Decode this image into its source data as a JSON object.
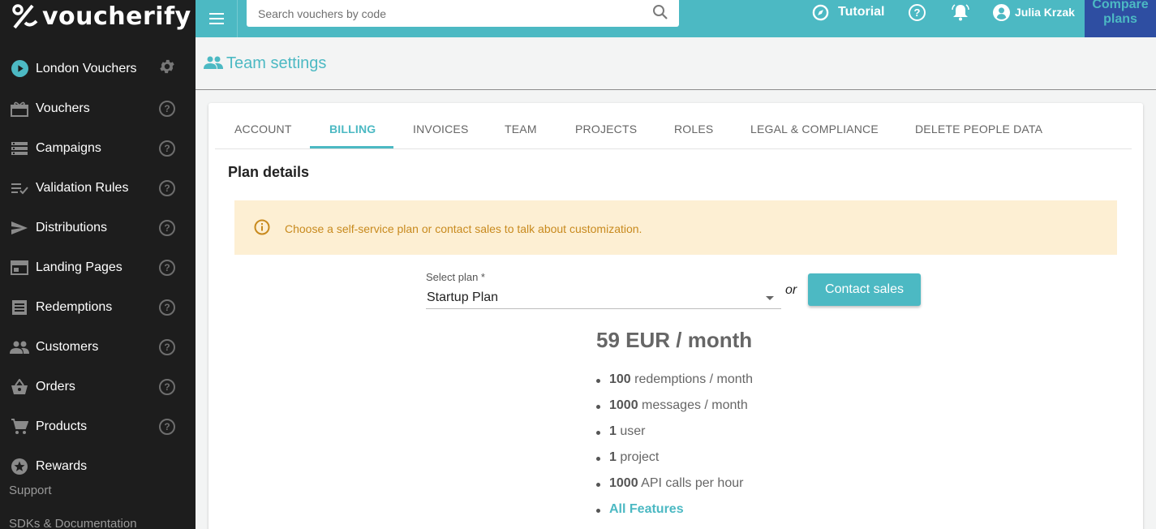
{
  "app": {
    "name": "voucherify"
  },
  "colors": {
    "accent": "#4cb9c3",
    "sidebar": "#1d1d1d",
    "compare_bg": "#2e4ea2",
    "alert_bg": "#fdefd3",
    "alert_text": "#c88a1e"
  },
  "sidebar": {
    "project": {
      "label": "London Vouchers",
      "icon": "play-circle-icon"
    },
    "items": [
      {
        "label": "Vouchers",
        "icon": "gift-icon"
      },
      {
        "label": "Campaigns",
        "icon": "list-icon"
      },
      {
        "label": "Validation Rules",
        "icon": "rules-icon"
      },
      {
        "label": "Distributions",
        "icon": "send-icon"
      },
      {
        "label": "Landing Pages",
        "icon": "web-icon"
      },
      {
        "label": "Redemptions",
        "icon": "receipt-icon"
      },
      {
        "label": "Customers",
        "icon": "people-icon"
      },
      {
        "label": "Orders",
        "icon": "basket-icon"
      },
      {
        "label": "Products",
        "icon": "cart-icon"
      },
      {
        "label": "Rewards",
        "icon": "star-icon"
      }
    ],
    "links": {
      "support": "Support",
      "sdks": "SDKs & Documentation"
    }
  },
  "topbar": {
    "search_placeholder": "Search vouchers by code",
    "tutorial": "Tutorial",
    "user": "Julia Krzak",
    "compare": "Compare plans"
  },
  "page": {
    "title": "Team settings"
  },
  "tabs": [
    {
      "label": "ACCOUNT",
      "active": false
    },
    {
      "label": "BILLING",
      "active": true
    },
    {
      "label": "INVOICES",
      "active": false
    },
    {
      "label": "TEAM",
      "active": false
    },
    {
      "label": "PROJECTS",
      "active": false
    },
    {
      "label": "ROLES",
      "active": false
    },
    {
      "label": "LEGAL & COMPLIANCE",
      "active": false
    },
    {
      "label": "DELETE PEOPLE DATA",
      "active": false
    }
  ],
  "billing": {
    "section_title": "Plan details",
    "alert": "Choose a self-service plan or contact sales to talk about customization.",
    "select_label": "Select plan *",
    "selected_plan": "Startup Plan",
    "or": "or",
    "contact_button": "Contact sales",
    "price": "59 EUR / month",
    "features": [
      {
        "value": "100",
        "text": " redemptions / month"
      },
      {
        "value": "1000",
        "text": " messages / month"
      },
      {
        "value": "1",
        "text": " user"
      },
      {
        "value": "1",
        "text": " project"
      },
      {
        "value": "1000",
        "text": " API calls per hour"
      }
    ],
    "all_features": "All Features"
  }
}
